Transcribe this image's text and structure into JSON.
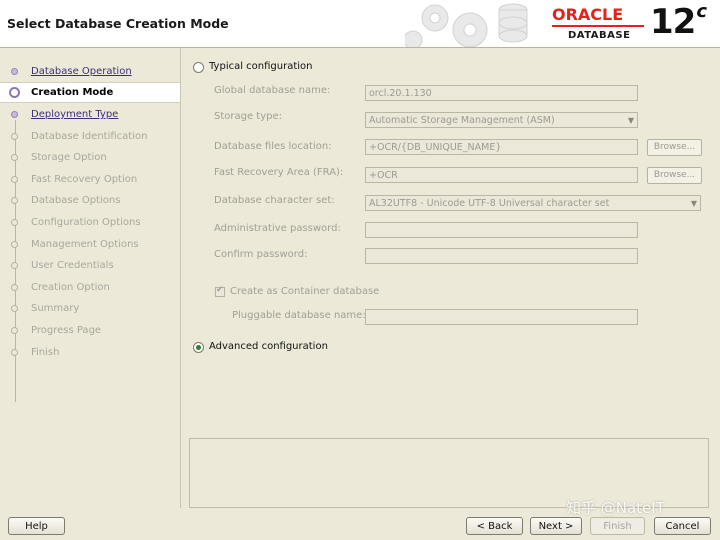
{
  "header": {
    "title": "Select Database Creation Mode",
    "logo": {
      "brand": "ORACLE",
      "product": "DATABASE",
      "version": "12",
      "version_suffix": "c"
    }
  },
  "sidebar": {
    "steps": [
      {
        "label": "Database Operation",
        "state": "done"
      },
      {
        "label": "Creation Mode",
        "state": "current"
      },
      {
        "label": "Deployment Type",
        "state": "done"
      },
      {
        "label": "Database Identification",
        "state": "pending"
      },
      {
        "label": "Storage Option",
        "state": "pending"
      },
      {
        "label": "Fast Recovery Option",
        "state": "pending"
      },
      {
        "label": "Database Options",
        "state": "pending"
      },
      {
        "label": "Configuration Options",
        "state": "pending"
      },
      {
        "label": "Management Options",
        "state": "pending"
      },
      {
        "label": "User Credentials",
        "state": "pending"
      },
      {
        "label": "Creation Option",
        "state": "pending"
      },
      {
        "label": "Summary",
        "state": "pending"
      },
      {
        "label": "Progress Page",
        "state": "pending"
      },
      {
        "label": "Finish",
        "state": "pending"
      }
    ]
  },
  "main": {
    "typical": {
      "label": "Typical configuration",
      "selected": false,
      "fields": {
        "global_db_name": {
          "label": "Global database name:",
          "value": "orcl.20.1.130"
        },
        "storage_type": {
          "label": "Storage type:",
          "value": "Automatic Storage Management (ASM)"
        },
        "db_files_location": {
          "label": "Database files location:",
          "value": "+OCR/{DB_UNIQUE_NAME}"
        },
        "fra": {
          "label": "Fast Recovery Area (FRA):",
          "value": "+OCR"
        },
        "charset": {
          "label": "Database character set:",
          "value": "AL32UTF8 - Unicode UTF-8 Universal character set"
        },
        "admin_password": {
          "label": "Administrative password:",
          "value": ""
        },
        "confirm_password": {
          "label": "Confirm password:",
          "value": ""
        },
        "pluggable_db_name": {
          "label": "Pluggable database name:",
          "value": ""
        }
      },
      "browse_label": "Browse...",
      "container_db": {
        "label": "Create as Container database",
        "checked": true
      }
    },
    "advanced": {
      "label": "Advanced configuration",
      "selected": true
    }
  },
  "footer": {
    "help": "Help",
    "back": "< Back",
    "next": "Next >",
    "finish": "Finish",
    "cancel": "Cancel"
  },
  "watermark": "知乎 @NateIT",
  "colors": {
    "accent": "#e8201a",
    "radio_selected": "#2e7d32",
    "step_done": "#3e2e7a",
    "background": "#ece9d8"
  }
}
